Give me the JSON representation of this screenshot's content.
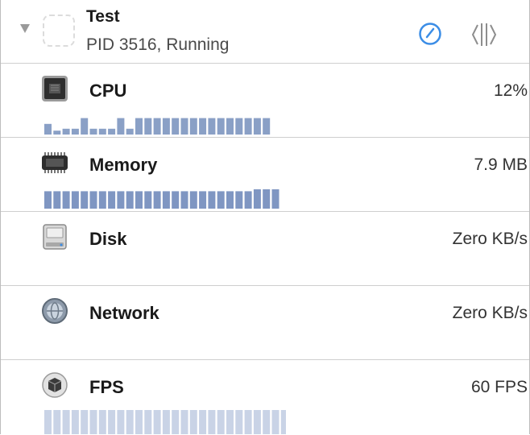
{
  "process": {
    "name": "Test",
    "status": "PID 3516, Running"
  },
  "gauges": [
    {
      "key": "cpu",
      "label": "CPU",
      "value": "12%",
      "icon": "cpu-chip-icon",
      "history": [
        0.55,
        0.2,
        0.3,
        0.3,
        0.85,
        0.3,
        0.3,
        0.3,
        0.85,
        0.3,
        0.85,
        0.85,
        0.85,
        0.85,
        0.85,
        0.85,
        0.85,
        0.85,
        0.85,
        0.85,
        0.85,
        0.85,
        0.85,
        0.85,
        0.85
      ],
      "bar_color": "#8aa0c6"
    },
    {
      "key": "memory",
      "label": "Memory",
      "value": "7.9 MB",
      "icon": "memory-chip-icon",
      "history": [
        0.9,
        0.9,
        0.9,
        0.9,
        0.9,
        0.9,
        0.9,
        0.9,
        0.9,
        0.9,
        0.9,
        0.9,
        0.9,
        0.9,
        0.9,
        0.9,
        0.9,
        0.9,
        0.9,
        0.9,
        0.9,
        0.9,
        0.9,
        1.0,
        1.0,
        1.0
      ],
      "bar_color": "#7f96c2"
    },
    {
      "key": "disk",
      "label": "Disk",
      "value": "Zero KB/s",
      "icon": "hard-disk-icon",
      "history": [],
      "bar_color": "#8aa0c6"
    },
    {
      "key": "network",
      "label": "Network",
      "value": "Zero KB/s",
      "icon": "network-globe-icon",
      "history": [],
      "bar_color": "#8aa0c6"
    },
    {
      "key": "fps",
      "label": "FPS",
      "value": "60 FPS",
      "icon": "gpu-cube-icon",
      "history": [
        1,
        1,
        1,
        1,
        1,
        1,
        1,
        1,
        1,
        1,
        1,
        1,
        1,
        1,
        1,
        1,
        1,
        1,
        1,
        1,
        1,
        1,
        1,
        1,
        1,
        1,
        1,
        1,
        1,
        1,
        1,
        1
      ],
      "bar_color": "#c9d3e6"
    }
  ],
  "colors": {
    "accent": "#3b8de6",
    "divider": "#cfcfcf"
  }
}
